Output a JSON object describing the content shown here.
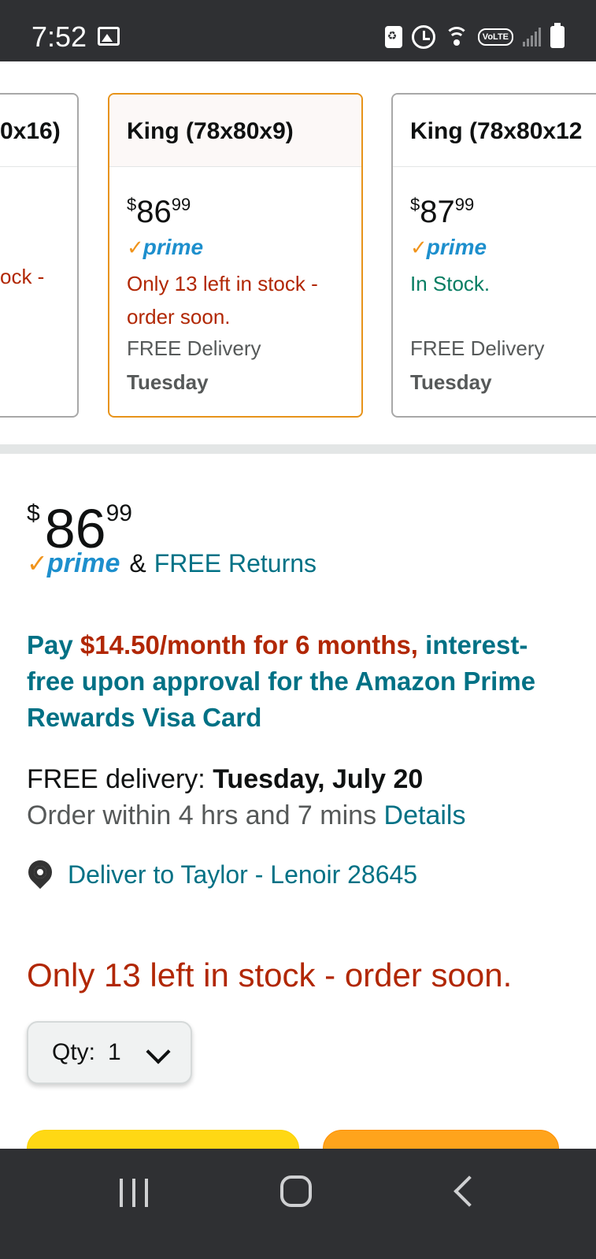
{
  "status_bar": {
    "time": "7:52",
    "volte": "VoLTE"
  },
  "carousel": {
    "cards": [
      {
        "title": "0x16)",
        "stock": "ock -"
      },
      {
        "title": "King (78x80x9)",
        "price_dollars": "86",
        "price_cents": "99",
        "prime": "prime",
        "stock": "Only 13 left in stock - order soon.",
        "delivery": "FREE Delivery",
        "delivery_day": "Tuesday",
        "selected": true
      },
      {
        "title": "King (78x80x12",
        "price_dollars": "87",
        "price_cents": "99",
        "prime": "prime",
        "stock": "In Stock.",
        "delivery": "FREE Delivery",
        "delivery_day": "Tuesday"
      }
    ]
  },
  "main": {
    "currency": "$",
    "price_dollars": "86",
    "price_cents": "99",
    "prime": "prime",
    "amp": "&",
    "free_returns": "FREE Returns",
    "finance_pre": "Pay ",
    "finance_highlight": "$14.50/month for 6 months,",
    "finance_post": " interest-free upon approval for the Amazon Prime Rewards Visa Card",
    "delivery_label": "FREE delivery: ",
    "delivery_date": "Tuesday, July 20",
    "order_within": "Order within 4 hrs and 7 mins ",
    "details_link": "Details",
    "deliver_to": "Deliver to Taylor - Lenoir 28645",
    "low_stock": "Only 13 left in stock - order soon.",
    "qty_label": "Qty:",
    "qty_value": "1"
  },
  "colors": {
    "link": "#007185",
    "alert": "#b12704",
    "in_stock": "#067d62",
    "selected_border": "#e7931a",
    "add_to_cart": "#ffd814",
    "buy_now": "#ffa41c"
  },
  "icons": {
    "location": "location-pin-icon",
    "qty_dropdown": "chevron-down-icon",
    "nav_recent": "recent-apps-icon",
    "nav_home": "home-icon",
    "nav_back": "back-icon"
  }
}
